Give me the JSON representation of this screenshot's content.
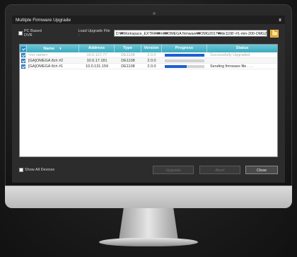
{
  "window": {
    "title": "Multiple Firmware Upgrade",
    "close_glyph": "x"
  },
  "toolbar": {
    "pc_based_dvr_label": "PC Based DVR",
    "pc_based_dvr_checked": false,
    "load_label": "Load Upgrade File :",
    "file_path": "D:₩Workspace_EXTRA₩mt₩OMEGA firmware₩OMG2017₩de1108~#1-min-200-OMG20"
  },
  "table": {
    "columns": [
      "Name",
      "Address",
      "Type",
      "Version",
      "Progress",
      "Status"
    ],
    "sort_glyph": "▼",
    "rows": [
      {
        "name": "<no name>",
        "address": "10.0.127.77",
        "type": "DE1108",
        "version": "2.0.0",
        "progress": 1.0,
        "status": "Successfully Upgraded",
        "checked": true,
        "dimmed": true
      },
      {
        "name": "[GA]OMEGA 8ch #2",
        "address": "10.0.17.181",
        "type": "DE1108",
        "version": "2.0.0",
        "progress": 0.0,
        "status": "",
        "checked": true,
        "dimmed": false
      },
      {
        "name": "[GA]OMEGA 8ch #1",
        "address": "10.0.131.159",
        "type": "DE1108",
        "version": "2.0.0",
        "progress": 0.55,
        "status": "Sending firmware file . . .",
        "checked": true,
        "dimmed": false
      }
    ]
  },
  "footer": {
    "show_all_label": "Show All Devices",
    "show_all_checked": false,
    "upgrade_label": "Upgrade",
    "abort_label": "Abort",
    "close_label": "Close"
  },
  "colors": {
    "header_accent": "#3aa9bd",
    "progress_fill": "#1e5fd0",
    "folder_button": "#d9a032"
  }
}
